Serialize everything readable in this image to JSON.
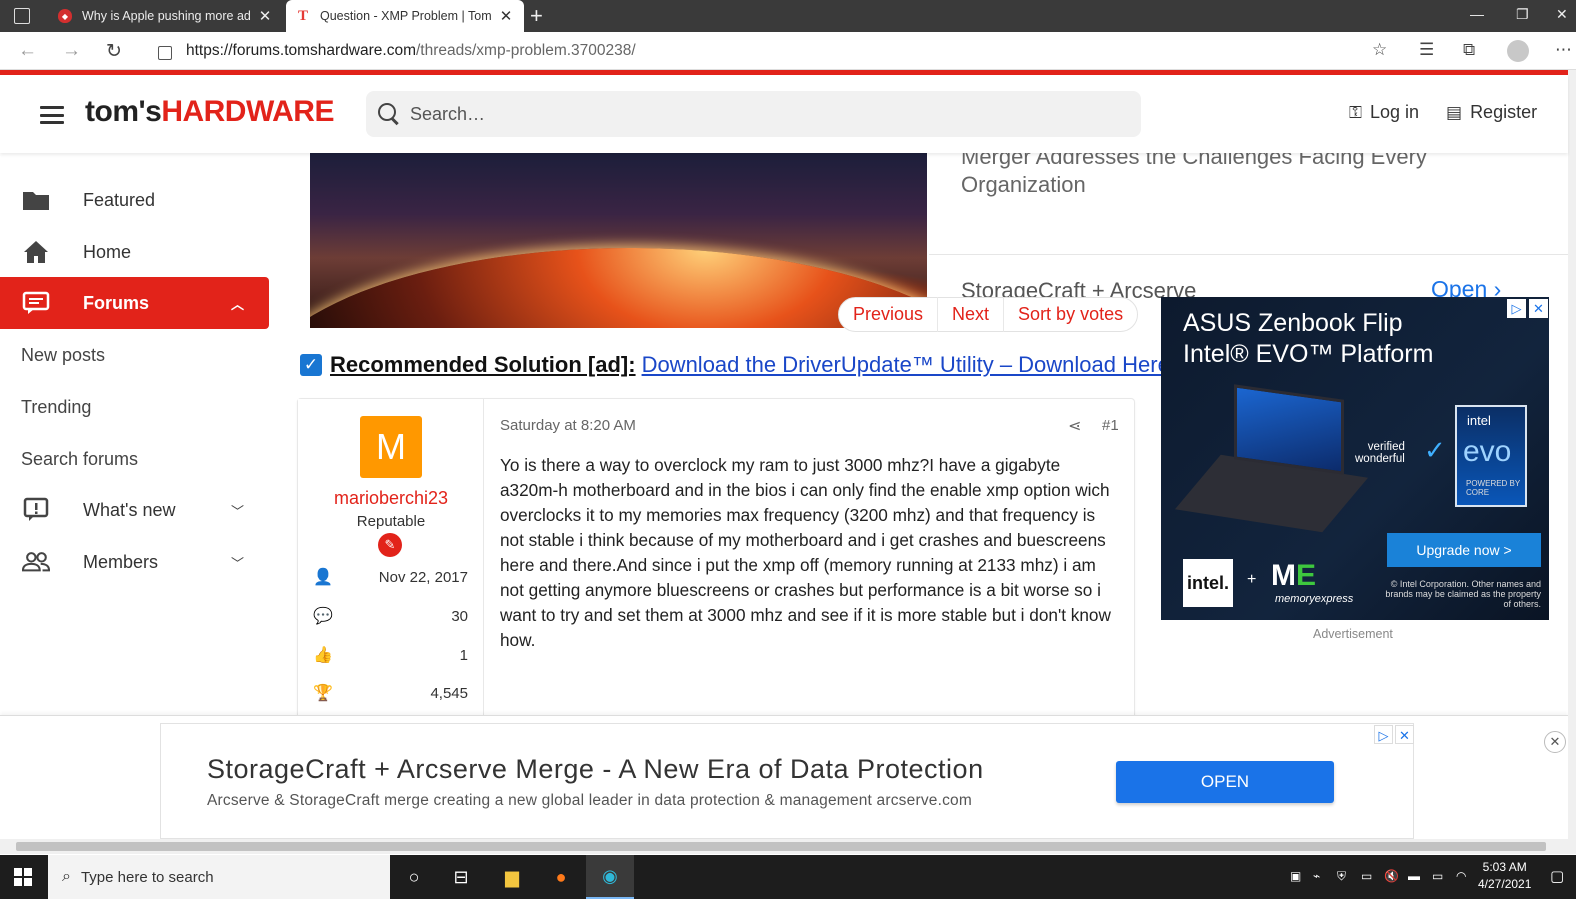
{
  "browser": {
    "tabs": [
      {
        "title": "Why is Apple pushing more ads",
        "active": false
      },
      {
        "title": "Question - XMP Problem | Tom's",
        "active": true
      }
    ],
    "url_domain": "https://forums.tomshardware.com",
    "url_path": "/threads/xmp-problem.3700238/"
  },
  "site": {
    "logo_part1": "tom's",
    "logo_part2": "HARDWARE",
    "search_placeholder": "Search…",
    "login_label": "Log in",
    "register_label": "Register",
    "accent_color": "#e2231a"
  },
  "sidebar": {
    "items": [
      {
        "label": "Featured",
        "icon": "folder-icon"
      },
      {
        "label": "Home",
        "icon": "home-icon"
      },
      {
        "label": "Forums",
        "icon": "forum-icon",
        "active": true
      },
      {
        "label": "What's new",
        "icon": "alert-bubble-icon"
      },
      {
        "label": "Members",
        "icon": "members-icon"
      }
    ],
    "subitems": [
      "New posts",
      "Trending",
      "Search forums"
    ]
  },
  "featured": {
    "headline_partial": "Merger Addresses the Challenges Facing Every Organization",
    "second_item": "StorageCraft + Arcserve",
    "open_label": "Open"
  },
  "thread_nav": {
    "previous": "Previous",
    "next": "Next",
    "sort": "Sort by votes"
  },
  "recommended": {
    "label": "Recommended Solution [ad]:",
    "link": "Download the DriverUpdate™ Utility – Download Here"
  },
  "post": {
    "avatar_letter": "M",
    "username": "marioberchi23",
    "user_title": "Reputable",
    "joined": "Nov 22, 2017",
    "messages": "30",
    "reactions": "1",
    "points": "4,545",
    "date": "Saturday at 8:20 AM",
    "number": "#1",
    "body": "Yo is there a way to overclock my ram to just 3000 mhz?I have a gigabyte a320m-h motherboard and in the bios i can only find the enable xmp option wich overclocks it to my memories max frequency (3200 mhz) and that frequency is not stable i think because of my motherboard and i get crashes and buescreens here and there.And since i put the xmp off (memory running at 2133 mhz) i am not getting anymore bluescreens or crashes but performance is a bit worse so i want to try and set them at 3000 mhz and see if it is more stable but i don't know how."
  },
  "side_ad": {
    "line1": "ASUS Zenbook Flip",
    "line2": "Intel® EVO™ Platform",
    "verified": "verified\nwonderful",
    "evo_intel": "intel",
    "evo_word": "evo",
    "evo_core": "POWERED BY CORE",
    "upgrade": "Upgrade now >",
    "intel_logo": "intel.",
    "plus": "+",
    "memx": "ME",
    "memx_sub": "memoryexpress",
    "fine_print": "© Intel Corporation. Other names and brands may be claimed as the property of others.",
    "caption": "Advertisement"
  },
  "bottom_ad": {
    "title": "StorageCraft + Arcserve Merge - A New Era of Data Protection",
    "subtitle": "Arcserve & StorageCraft merge creating a new global leader in data protection & management arcserve.com",
    "button": "OPEN"
  },
  "taskbar": {
    "search_placeholder": "Type here to search",
    "time": "5:03 AM",
    "date": "4/27/2021"
  }
}
